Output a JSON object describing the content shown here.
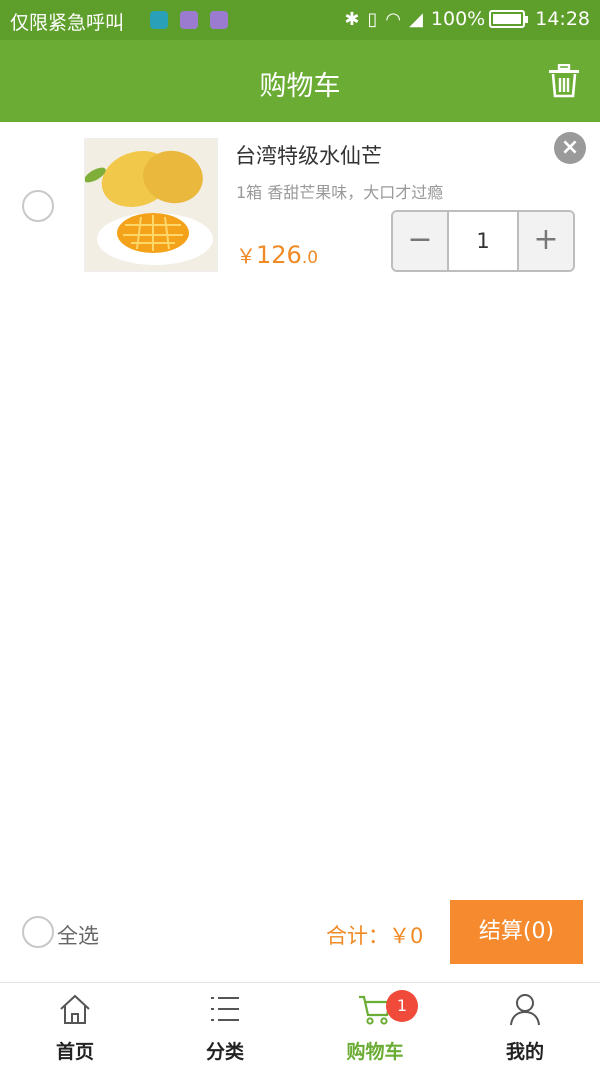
{
  "status_bar": {
    "carrier": "仅限紧急呼叫",
    "battery": "100%",
    "time": "14:28"
  },
  "header": {
    "title": "购物车"
  },
  "cart_items": [
    {
      "name": "台湾特级水仙芒",
      "spec": "1箱   香甜芒果味，大口才过瘾",
      "price_currency": "￥",
      "price_integer": "126",
      "price_decimal": ".0",
      "quantity": "1",
      "decrement_label": "−",
      "increment_label": "+",
      "remove_label": "×"
    }
  ],
  "checkout": {
    "select_all_label": "全选",
    "total_label": "合计：￥0",
    "checkout_button": "结算(0)"
  },
  "tabs": [
    {
      "label": "首页",
      "icon": "home-icon"
    },
    {
      "label": "分类",
      "icon": "list-icon"
    },
    {
      "label": "购物车",
      "icon": "cart-icon",
      "active": true
    },
    {
      "label": "我的",
      "icon": "user-icon"
    }
  ],
  "cart_badge": "1",
  "colors": {
    "header_green": "#6aac34",
    "status_green": "#5e9e2a",
    "accent_orange": "#f58b2e",
    "badge_red": "#f04a3a"
  }
}
